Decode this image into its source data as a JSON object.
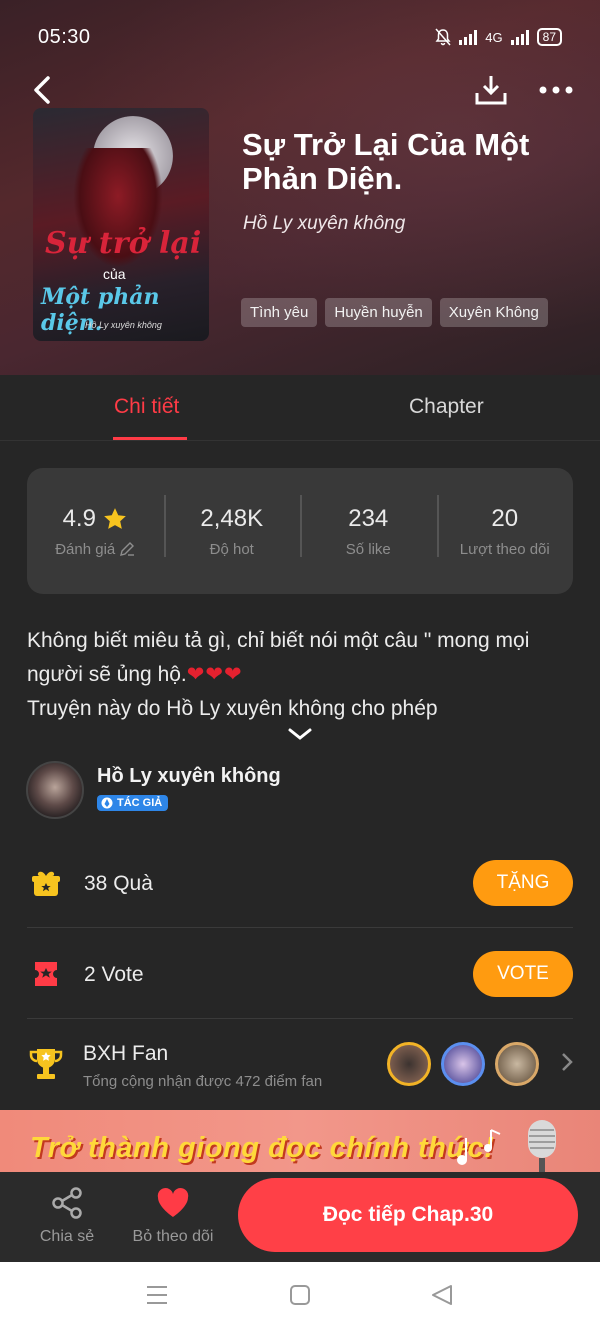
{
  "statusbar": {
    "time": "05:30",
    "network": "4G",
    "battery": "87"
  },
  "book": {
    "title": "Sự Trở Lại Của Một Phản Diện.",
    "author": "Hồ Ly xuyên không",
    "tags": [
      "Tình yêu",
      "Huyền huyễn",
      "Xuyên Không"
    ],
    "cover": {
      "line1": "Sự trở lại",
      "line2": "của",
      "line3": "Một phản diện.",
      "line4": "Hồ Ly xuyên không"
    }
  },
  "tabs": {
    "details": "Chi tiết",
    "chapter": "Chapter"
  },
  "stats": [
    {
      "value": "4.9",
      "label": "Đánh giá"
    },
    {
      "value": "2,48K",
      "label": "Độ hot"
    },
    {
      "value": "234",
      "label": "Số like"
    },
    {
      "value": "20",
      "label": "Lượt theo dõi"
    }
  ],
  "description": {
    "line1": "Không biết miêu tả gì, chỉ biết nói một câu \" mong mọi người sẽ ủng hộ.",
    "hearts": "❤❤❤",
    "line2": "Truyện này do Hồ Ly xuyên không cho phép"
  },
  "author_block": {
    "name": "Hồ Ly xuyên không",
    "badge": "TÁC GIẢ"
  },
  "gifts": {
    "label": "38 Quà",
    "button": "TẶNG"
  },
  "votes": {
    "label": "2 Vote",
    "button": "VOTE"
  },
  "fan_rank": {
    "title": "BXH Fan",
    "subtitle": "Tổng cộng nhận được 472 điểm fan"
  },
  "banner": {
    "text": "Trở thành giọng đọc chính thức!"
  },
  "actions": {
    "share": "Chia sẻ",
    "unfollow": "Bỏ theo dõi",
    "read": "Đọc tiếp Chap.30"
  },
  "colors": {
    "accent": "#ff3b46",
    "orange": "#ff9b10",
    "background": "#262626"
  }
}
